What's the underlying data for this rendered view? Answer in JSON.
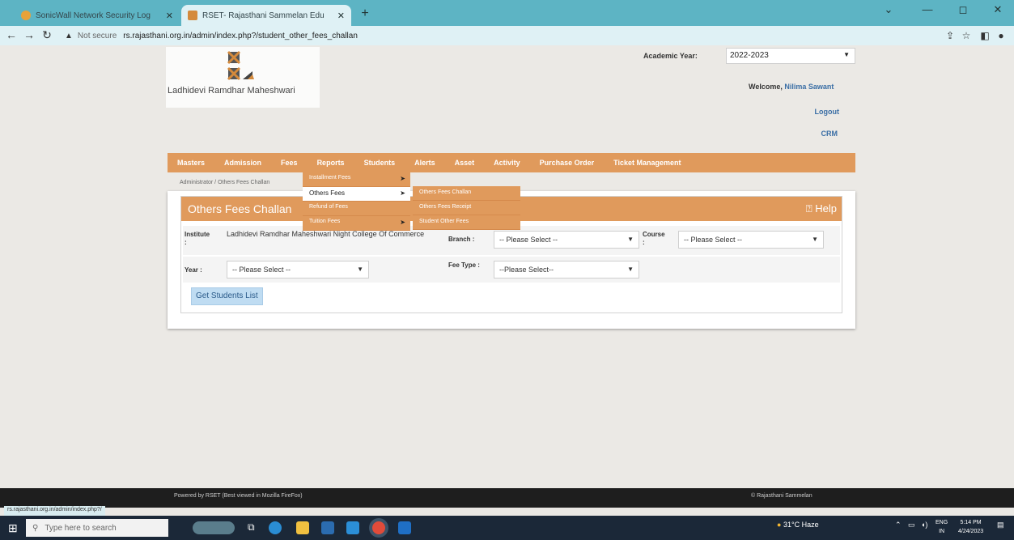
{
  "browser": {
    "tabs": [
      {
        "title": "SonicWall Network Security Log",
        "active": false,
        "close": "✕"
      },
      {
        "title": "RSET- Rajasthani Sammelan Edu",
        "active": true,
        "close": "✕"
      }
    ],
    "new_tab": "+",
    "security_label": "Not secure",
    "url": "rs.rajasthani.org.in/admin/index.php?/student_other_fees_challan",
    "window_controls": [
      "⌄",
      "—",
      "◻",
      "✕"
    ]
  },
  "header": {
    "logo_text": "Ladhidevi Ramdhar Maheshwari",
    "academic_year_label": "Academic Year:",
    "academic_year_value": "2022-2023",
    "welcome_label": "Welcome,",
    "user_name": "Nilima Sawant",
    "links": [
      "Logout",
      "CRM"
    ]
  },
  "nav": {
    "items": [
      "Masters",
      "Admission",
      "Fees",
      "Reports",
      "Students",
      "Alerts",
      "Asset",
      "Activity",
      "Purchase Order",
      "Ticket Management"
    ]
  },
  "breadcrumb": "Administrator / Others Fees Challan",
  "fees_menu": {
    "items": [
      {
        "label": "Installment Fees",
        "has_sub": true
      },
      {
        "label": "Others Fees",
        "has_sub": true,
        "selected": true
      },
      {
        "label": "Refund of Fees",
        "has_sub": false
      },
      {
        "label": "Tuition Fees",
        "has_sub": true
      }
    ],
    "submenu": [
      "Others Fees Challan",
      "Others Fees Receipt",
      "Student Other Fees"
    ]
  },
  "panel": {
    "title": "Others Fees Challan",
    "help": "Help",
    "institute_label": "Institute :",
    "institute_value": "Ladhidevi Ramdhar Maheshwari Night College Of Commerce",
    "branch_label": "Branch :",
    "branch_value": "-- Please Select --",
    "course_label": "Course :",
    "course_value": "-- Please Select --",
    "year_label": "Year :",
    "year_value": "-- Please Select --",
    "fee_type_label": "Fee Type :",
    "fee_type_value": "--Please Select--",
    "button_label": "Get Students List"
  },
  "footer": {
    "left": "Powered by RSET (Best viewed in Mozilla FireFox)",
    "right": "© Rajasthani Sammelan"
  },
  "status_url": "rs.rajasthani.org.in/admin/index.php?/",
  "taskbar": {
    "search_placeholder": "Type here to search",
    "weather": "31°C Haze",
    "lang_line1": "ENG",
    "lang_line2": "IN",
    "time": "5:14 PM",
    "date": "4/24/2023"
  }
}
